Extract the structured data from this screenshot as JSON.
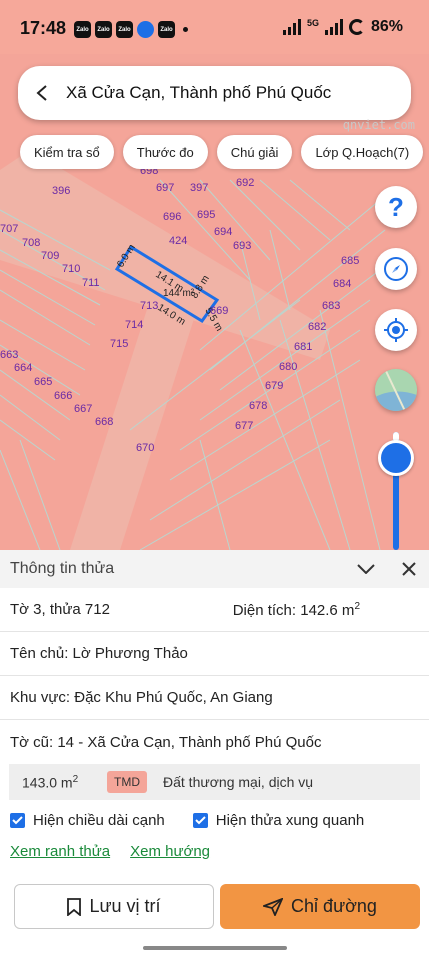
{
  "status_bar": {
    "time": "17:48",
    "notif_icons": [
      "Zalo",
      "Zalo",
      "Zalo",
      "Zalo"
    ],
    "network": "5G",
    "battery": "86%"
  },
  "search": {
    "title": "Xã Cửa Cạn, Thành phố Phú Quốc"
  },
  "watermark": "qnviet.com",
  "chips": [
    "Kiểm tra sổ",
    "Thước đo",
    "Chú giải",
    "Lớp Q.Hoạch(7)"
  ],
  "map": {
    "parcel_numbers": [
      "396",
      "697",
      "397",
      "698",
      "692",
      "707",
      "708",
      "709",
      "710",
      "711",
      "696",
      "695",
      "694",
      "693",
      "424",
      "685",
      "684",
      "683",
      "682",
      "681",
      "680",
      "679",
      "678",
      "677",
      "713",
      "714",
      "715",
      "663",
      "664",
      "665",
      "666",
      "667",
      "668",
      "669",
      "670"
    ],
    "selected_parcel": {
      "area_label": "144 m²",
      "edges": [
        "6.0 m",
        "14.1 m",
        "8.8 m",
        "14.0 m",
        "5.5 m"
      ],
      "number": "713"
    },
    "accent_color": "#1e6fe6",
    "land_color": "#f4a599"
  },
  "panel": {
    "title": "Thông tin thửa",
    "sheet_plot": "Tờ 3, thửa 712",
    "area": "Diện tích: 142.6 m",
    "area_sup": "2",
    "owner": "Tên chủ: Lờ Phương Thảo",
    "region": "Khu vực: Đặc Khu Phú Quốc, An Giang",
    "old_sheet": "Tờ cũ: 14 - Xã Cửa Cạn, Thành phố Phú Quốc",
    "land_use": {
      "area": "143.0 m",
      "area_sup": "2",
      "code": "TMD",
      "description": "Đất thương mại, dịch vụ"
    },
    "checkbox_edges": "Hiện chiều dài cạnh",
    "checkbox_surrounding": "Hiện thửa xung quanh",
    "link_boundary": "Xem ranh thửa",
    "link_direction": "Xem hướng",
    "save_button": "Lưu vị trí",
    "route_button": "Chỉ đường"
  }
}
